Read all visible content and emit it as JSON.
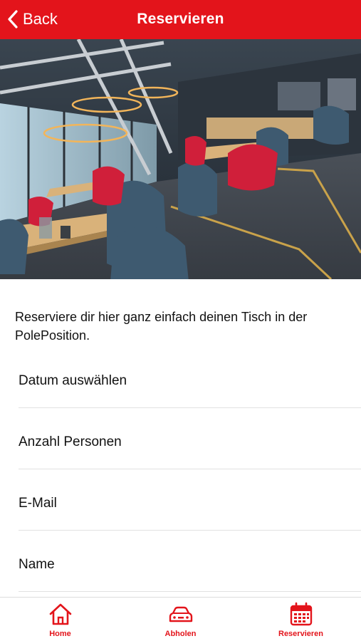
{
  "nav": {
    "back_label": "Back",
    "title": "Reservieren"
  },
  "hero": {
    "image": "restaurant-interior-photo"
  },
  "intro": {
    "text": "Reserviere dir hier ganz einfach deinen Tisch in der PolePosition."
  },
  "form": {
    "fields": [
      {
        "label": "Datum auswählen"
      },
      {
        "label": "Anzahl Personen"
      },
      {
        "label": "E-Mail"
      },
      {
        "label": "Name"
      }
    ]
  },
  "tabbar": {
    "items": [
      {
        "label": "Home",
        "icon": "home-icon"
      },
      {
        "label": "Abholen",
        "icon": "car-icon"
      },
      {
        "label": "Reservieren",
        "icon": "calendar-icon",
        "active": true
      }
    ]
  },
  "colors": {
    "accent": "#e3141b"
  }
}
